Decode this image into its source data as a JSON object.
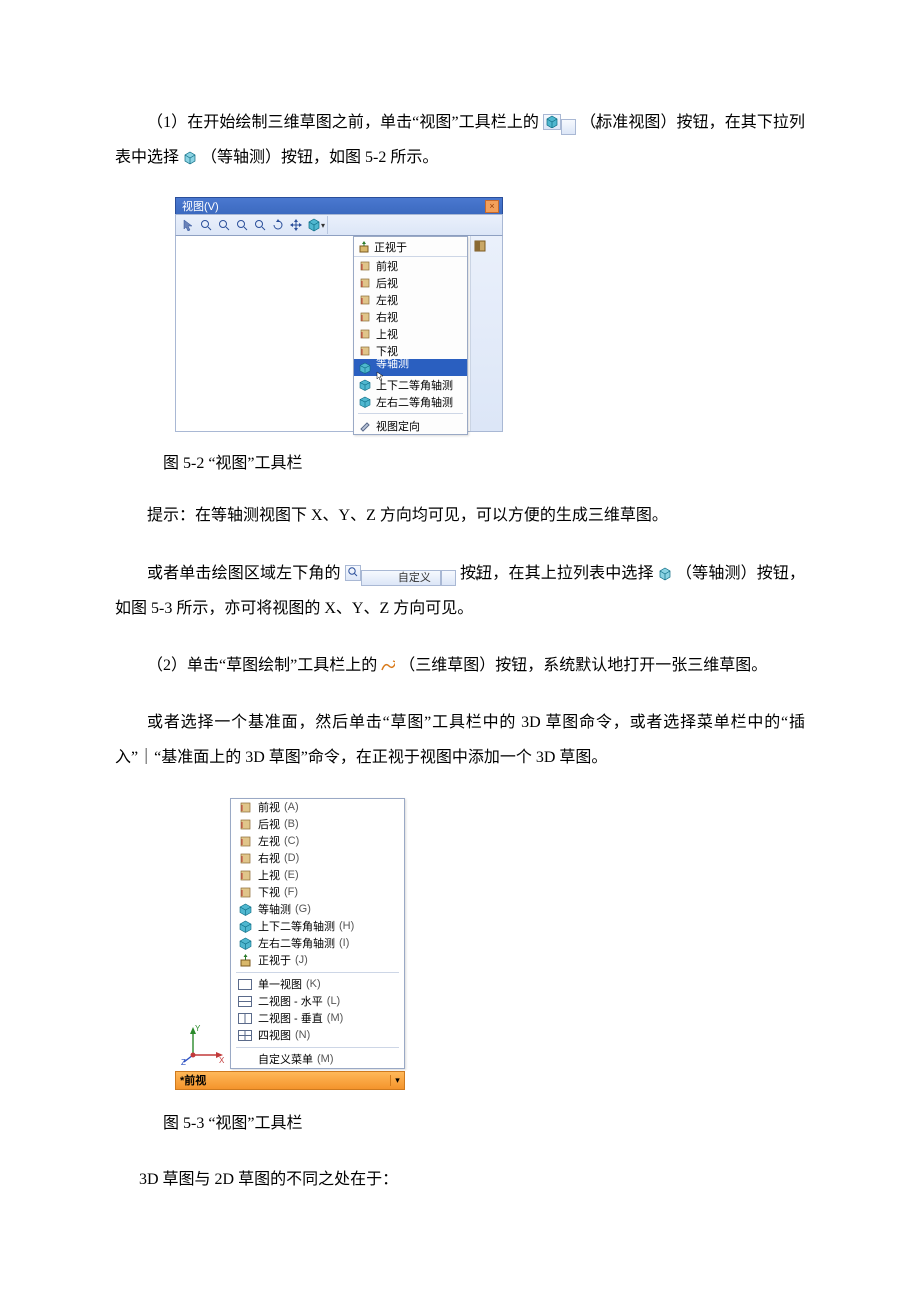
{
  "paragraphs": {
    "p1a": "（1）在开始绘制三维草图之前，单击“视图”工具栏上的",
    "p1b": "（标准视图）按钮，在其下拉列表中选择",
    "p1c": "（等轴测）按钮，如图 5-2 所示。",
    "cap52": "图 5-2  “视图”工具栏",
    "p2": "提示：在等轴测视图下 X、Y、Z 方向均可见，可以方便的生成三维草图。",
    "p3a": "或者单击绘图区域左下角的",
    "p3b": "按钮，在其上拉列表中选择",
    "p3c": "（等轴测）按钮，如图 5-3 所示，亦可将视图的 X、Y、Z 方向可见。",
    "p4a": "（2）单击“草图绘制”工具栏上的",
    "p4b": "（三维草图）按钮，系统默认地打开一张三维草图。",
    "p5": "或者选择一个基准面，然后单击“草图”工具栏中的 3D 草图命令，或者选择菜单栏中的“插入”｜“基准面上的 3D 草图”命令，在正视于视图中添加一个 3D 草图。",
    "cap53": "图 5-3  “视图”工具栏",
    "p6": "3D 草图与 2D 草图的不同之处在于："
  },
  "fig52": {
    "title": "视图(V)",
    "header_label": "正视于",
    "items": [
      {
        "label": "前视"
      },
      {
        "label": "后视"
      },
      {
        "label": "左视"
      },
      {
        "label": "右视"
      },
      {
        "label": "上视"
      },
      {
        "label": "下视"
      },
      {
        "label": "等轴测",
        "selected": true,
        "cube": "#4fb7cf"
      },
      {
        "label": "上下二等角轴测",
        "cube": "#4fb7cf"
      },
      {
        "label": "左右二等角轴测",
        "cube": "#4fb7cf"
      }
    ],
    "footer_label": "视图定向"
  },
  "inline": {
    "custom_btn_label": "自定义"
  },
  "fig53": {
    "groups": [
      [
        {
          "label": "前视",
          "key": "(A)"
        },
        {
          "label": "后视",
          "key": "(B)"
        },
        {
          "label": "左视",
          "key": "(C)"
        },
        {
          "label": "右视",
          "key": "(D)"
        },
        {
          "label": "上视",
          "key": "(E)"
        },
        {
          "label": "下视",
          "key": "(F)"
        },
        {
          "label": "等轴测",
          "key": "(G)",
          "cube": "#4fb7cf"
        },
        {
          "label": "上下二等角轴测",
          "key": "(H)",
          "cube": "#4fb7cf"
        },
        {
          "label": "左右二等角轴测",
          "key": "(I)",
          "cube": "#4fb7cf"
        },
        {
          "label": "正视于",
          "key": "(J)",
          "normal": true
        }
      ],
      [
        {
          "label": "单一视图",
          "key": "(K)",
          "pane": 1
        },
        {
          "label": "二视图 - 水平",
          "key": "(L)",
          "pane": 2
        },
        {
          "label": "二视图 - 垂直",
          "key": "(M)",
          "pane": 3
        },
        {
          "label": "四视图",
          "key": "(N)",
          "pane": 4
        }
      ],
      [
        {
          "label": "自定义菜单",
          "key": "(M)"
        }
      ]
    ],
    "bottom_label": "*前视"
  }
}
